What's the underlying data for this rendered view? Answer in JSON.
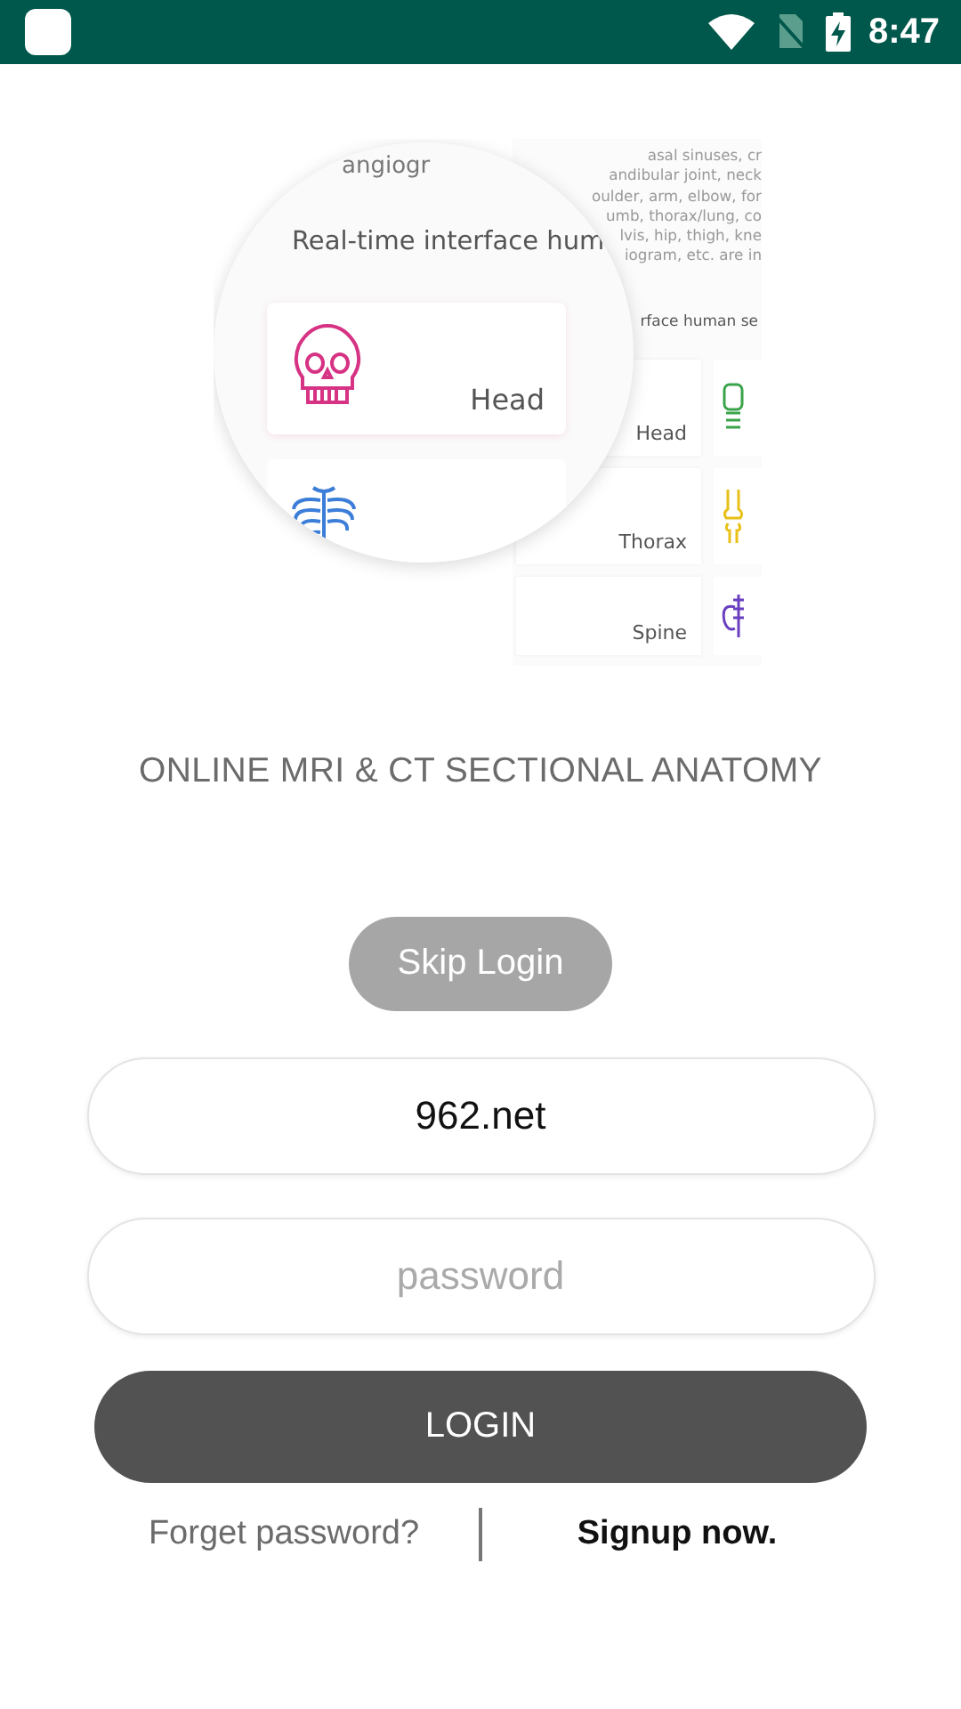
{
  "status_bar": {
    "time": "8:47"
  },
  "illustration": {
    "background": {
      "text_lines": [
        "asal sinuses, cr",
        "andibular joint, neck",
        "oulder, arm, elbow, for",
        "umb, thorax/lung, co",
        "lvis, hip, thigh, kne",
        "iogram, etc. are in"
      ],
      "subtitle": "rface human se",
      "tiles": [
        {
          "label": "Head"
        },
        {
          "label": "Thorax"
        },
        {
          "label": "Spine"
        }
      ]
    },
    "magnifier": {
      "top_text": "angiogr",
      "heading": "Real-time interface hum",
      "tile_label": "Head"
    }
  },
  "app_title": "ONLINE MRI & CT SECTIONAL ANATOMY",
  "skip_button": "Skip Login",
  "username": {
    "value": "962.net"
  },
  "password": {
    "placeholder": "password"
  },
  "login_button": "LOGIN",
  "forgot_link": "Forget password?",
  "signup_link": "Signup now."
}
